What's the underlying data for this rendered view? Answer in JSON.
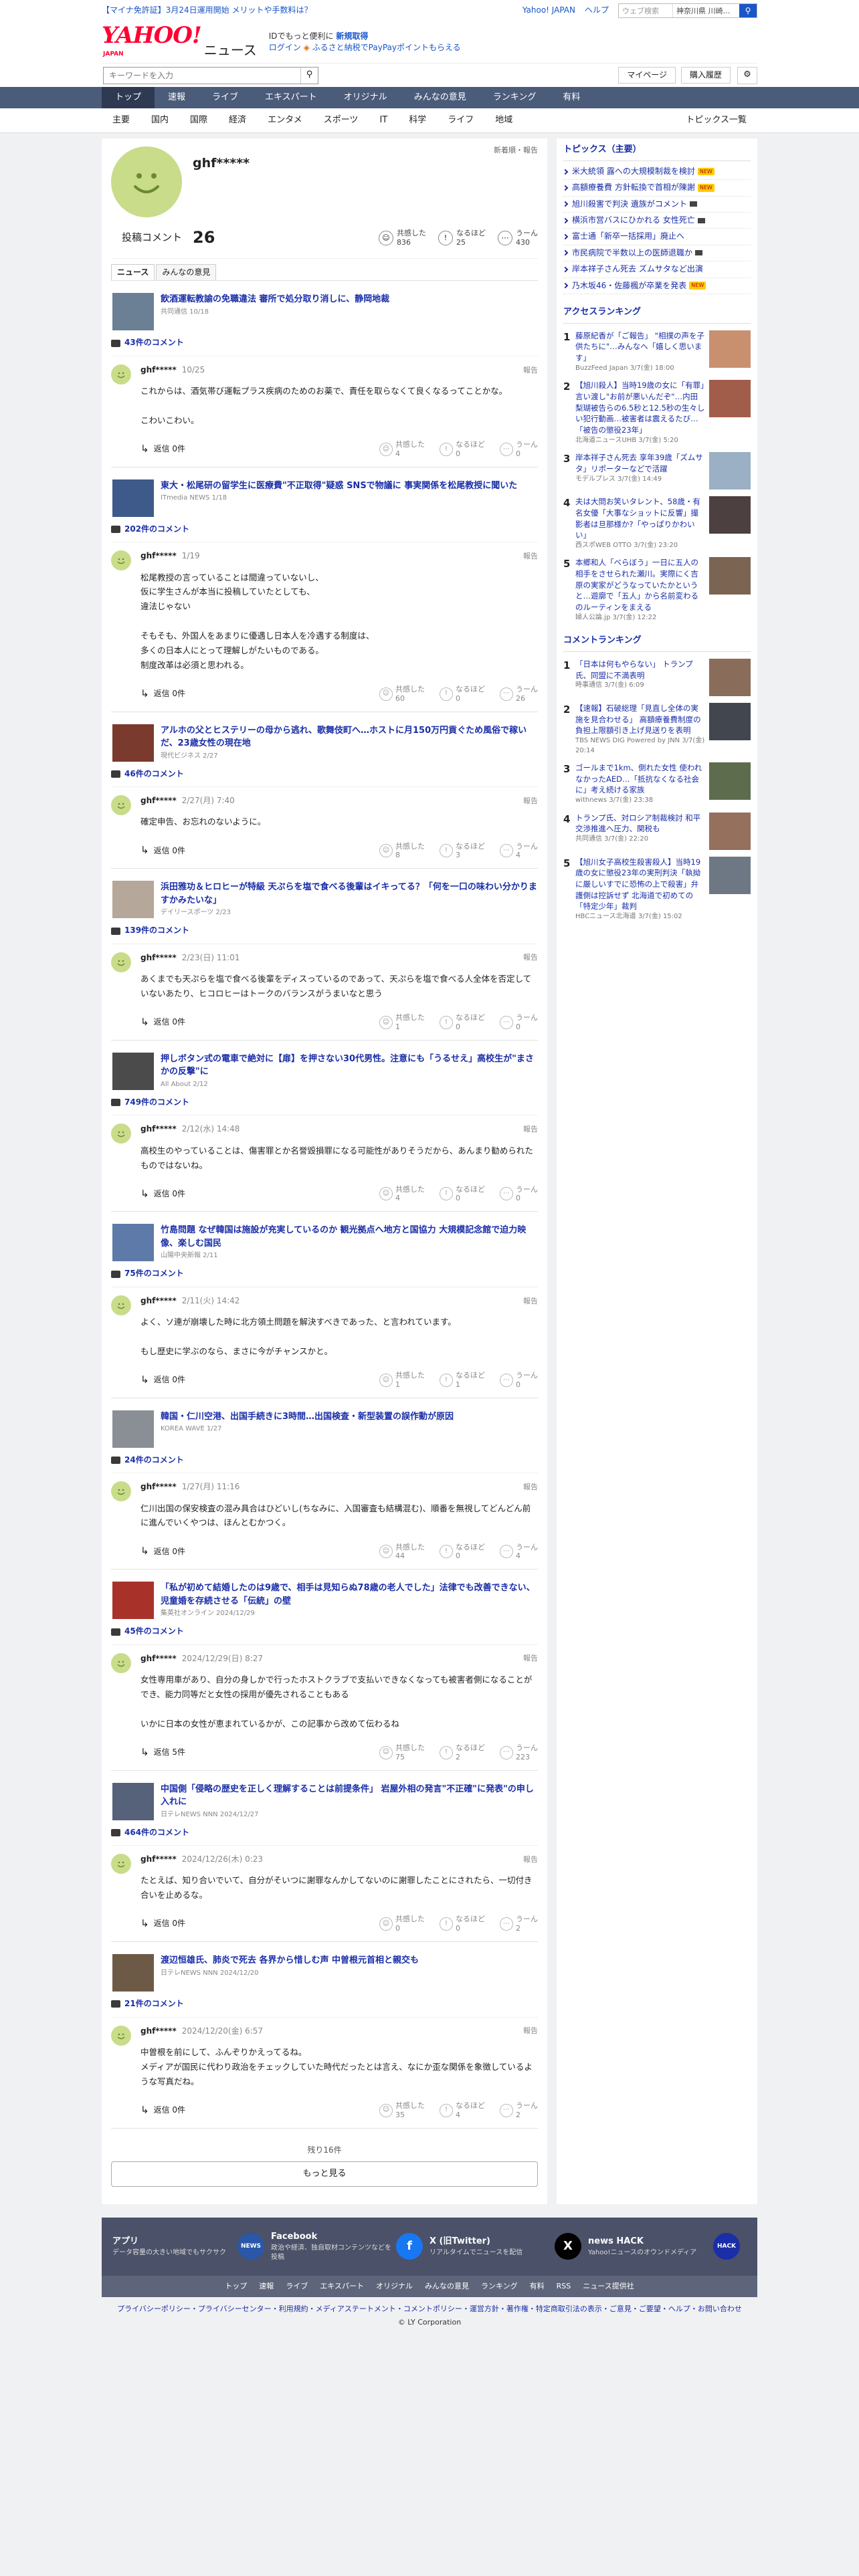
{
  "topbar": {
    "promo": "【マイナ免許証】3月24日運用開始 メリットや手数料は？",
    "links": [
      "Yahoo! JAPAN",
      "ヘルプ"
    ],
    "weather_placeholder": "ウェブ検索",
    "weather_location": "神奈川県 川崎…"
  },
  "header": {
    "logo_yahoo": "YAHOO!",
    "logo_japan": "JAPAN",
    "logo_news": "ニュース",
    "line1": "IDでもっと便利に",
    "line1_link": "新規取得",
    "login": "ログイン",
    "line2": "ふるさと納税でPayPayポイントもらえる"
  },
  "search": {
    "placeholder": "キーワードを入力",
    "mypage": "マイページ",
    "history": "購入履歴"
  },
  "main_nav": [
    "トップ",
    "速報",
    "ライブ",
    "エキスパート",
    "オリジナル",
    "みんなの意見",
    "ランキング",
    "有料"
  ],
  "sub_nav": [
    "主要",
    "国内",
    "国際",
    "経済",
    "エンタメ",
    "スポーツ",
    "IT",
    "科学",
    "ライフ",
    "地域"
  ],
  "sub_nav_right": "トピックス一覧",
  "profile": {
    "name": "ghf*****",
    "newest": "新着順・報告",
    "posted_label": "投稿コメント",
    "posted_count": "26",
    "stats": [
      {
        "label": "共感した",
        "value": "836"
      },
      {
        "label": "なるほど",
        "value": "25"
      },
      {
        "label": "うーん",
        "value": "430"
      }
    ],
    "tabs": [
      "ニュース",
      "みんなの意見"
    ]
  },
  "labels": {
    "reply": "返信",
    "report": "報告",
    "like": "共感した",
    "naruhodo": "なるほど",
    "hmm": "うーん",
    "remaining": "残り16件",
    "more": "もっと見る"
  },
  "items": [
    {
      "title": "飲酒運転教諭の免職違法 審所で処分取り消しに、静岡地裁",
      "source": "共同通信 10/18",
      "comments": "43件のコメント",
      "date": "10/25",
      "text": "これからは、酒気帯び運転プラス疾病のためのお薬で、責任を取らなくて良くなるってことかな。\n\nこわいこわい。",
      "replies": "返信 0件",
      "like": "4",
      "naru": "0",
      "hmm": "0",
      "color": "#6b7f95"
    },
    {
      "title": "東大・松尾研の留学生に医療費\"不正取得\"疑惑 SNSで物議に 事実関係を松尾教授に聞いた",
      "source": "ITmedia NEWS 1/18",
      "comments": "202件のコメント",
      "date": "1/19",
      "text": "松尾教授の言っていることは間違っていないし、\n仮に学生さんが本当に投稿していたとしても、\n違法じゃない\n\nそもそも、外国人をあまりに優遇し日本人を冷遇する制度は、\n多くの日本人にとって理解しがたいものである。\n制度改革は必須と思われる。",
      "replies": "返信 0件",
      "like": "60",
      "naru": "0",
      "hmm": "26",
      "color": "#3d5a8a"
    },
    {
      "title": "アルホの父とヒステリーの母から逃れ、歌舞伎町へ…ホストに月150万円貢ぐため風俗で稼いだ、23歳女性の現在地",
      "source": "現代ビジネス 2/27",
      "comments": "46件のコメント",
      "date": "2/27(月) 7:40",
      "text": "確定申告、お忘れのないように。",
      "replies": "返信 0件",
      "like": "8",
      "naru": "3",
      "hmm": "4",
      "color": "#7a3b2e"
    },
    {
      "title": "浜田雅功＆ヒロヒーが特級 天ぷらを塩で食べる後輩はイキってる？「何を一口の味わい分かりますかみたいな」",
      "source": "デイリースポーツ 2/23",
      "comments": "139件のコメント",
      "date": "2/23(日) 11:01",
      "text": "あくまでも天ぷらを塩で食べる後輩をディスっているのであって、天ぷらを塩で食べる人全体を否定していないあたり、ヒコロヒーはトークのバランスがうまいなと思う",
      "replies": "返信 0件",
      "like": "1",
      "naru": "0",
      "hmm": "0",
      "color": "#b5a79a"
    },
    {
      "title": "押しボタン式の電車で絶対に【扉】を押さない30代男性。注意にも「うるせえ」高校生が\"まさかの反撃\"に",
      "source": "All About 2/12",
      "comments": "749件のコメント",
      "date": "2/12(水) 14:48",
      "text": "高校生のやっていることは、傷害罪とか名誉毀損罪になる可能性がありそうだから、あんまり勧められたものではないね。",
      "replies": "返信 0件",
      "like": "4",
      "naru": "0",
      "hmm": "0",
      "color": "#4b4b4b"
    },
    {
      "title": "竹島問題 なぜ韓国は施設が充実しているのか 観光拠点へ地方と国協力 大規模記念館で迫力映像、楽しむ国民",
      "source": "山陽中央新報 2/11",
      "comments": "75件のコメント",
      "date": "2/11(火) 14:42",
      "text": "よく、ソ連が崩壊した時に北方領土問題を解決すべきであった、と言われています。\n\nもし歴史に学ぶのなら、まさに今がチャンスかと。",
      "replies": "返信 0件",
      "like": "1",
      "naru": "1",
      "hmm": "0",
      "color": "#5d7aa8"
    },
    {
      "title": "韓国・仁川空港、出国手続きに3時間…出国検査・新型装置の誤作動が原因",
      "source": "KOREA WAVE 1/27",
      "comments": "24件のコメント",
      "date": "1/27(月) 11:16",
      "text": "仁川出国の保安検査の混み具合はひどいし(ちなみに、入国審査も結構混む)、順番を無視してどんどん前に進んでいくやつは、ほんとむかつく。",
      "replies": "返信 0件",
      "like": "44",
      "naru": "0",
      "hmm": "4",
      "color": "#8a8f96"
    },
    {
      "title": "「私が初めて結婚したのは9歳で、相手は見知らぬ78歳の老人でした」法律でも改善できない、児童婚を存続させる「伝統」の壁",
      "source": "集英社オンライン 2024/12/29",
      "comments": "45件のコメント",
      "date": "2024/12/29(日) 8:27",
      "text": "女性専用車があり、自分の身しかで行ったホストクラブで支払いできなくなっても被害者側になることができ、能力同等だと女性の採用が優先されることもある\n\nいかに日本の女性が恵まれているかが、この記事から改めて伝わるね",
      "replies": "返信 5件",
      "like": "75",
      "naru": "2",
      "hmm": "223",
      "color": "#a8322a"
    },
    {
      "title": "中国側「侵略の歴史を正しく理解することは前提条件」 岩屋外相の発言\"不正確\"に発表\"の申し入れに",
      "source": "日テレNEWS NNN 2024/12/27",
      "comments": "464件のコメント",
      "date": "2024/12/26(木) 0:23",
      "text": "たとえば、知り合いでいて、自分がそいつに謝罪なんかしてないのに謝罪したことにされたら、一切付き合いを止めるな。",
      "replies": "返信 0件",
      "like": "0",
      "naru": "0",
      "hmm": "2",
      "color": "#56617a"
    },
    {
      "title": "渡辺恒雄氏、肺炎で死去 各界から惜しむ声 中曽根元首相と親交も",
      "source": "日テレNEWS NNN 2024/12/20",
      "comments": "21件のコメント",
      "date": "2024/12/20(金) 6:57",
      "text": "中曽根を前にして、ふんぞりかえってるね。\nメディアが国民に代わり政治をチェックしていた時代だったとは言え、なにか歪な関係を象徴しているような写真だね。",
      "replies": "返信 0件",
      "like": "35",
      "naru": "4",
      "hmm": "2",
      "color": "#6d5a46"
    }
  ],
  "side": {
    "topics_title": "トピックス（主要）",
    "topics": [
      {
        "text": "米大統領 露への大規模制裁を検討",
        "badge": "NEW",
        "cam": false
      },
      {
        "text": "高額療養費 方針転換で首相が陳謝",
        "badge": "NEW",
        "cam": false
      },
      {
        "text": "旭川殺害で判決 遺族がコメント",
        "badge": "",
        "cam": true
      },
      {
        "text": "横浜市営バスにひかれる 女性死亡",
        "badge": "",
        "cam": true
      },
      {
        "text": "富士通「新卒一括採用」廃止へ",
        "badge": "",
        "cam": false
      },
      {
        "text": "市民病院で半数以上の医師退職か",
        "badge": "",
        "cam": true
      },
      {
        "text": "岸本祥子さん死去 ズムサタなど出演",
        "badge": "",
        "cam": false
      },
      {
        "text": "乃木坂46・佐藤楓が卒業を発表",
        "badge": "NEW",
        "cam": false
      }
    ],
    "access_title": "アクセスランキング",
    "access": [
      {
        "text": "藤原紀香が「ご報告」 \"相撲の声を子供たちに\"…みんなへ「嬉しく思います」",
        "meta": "BuzzFeed Japan 3/7(金) 18:00",
        "color": "#c99070"
      },
      {
        "text": "【旭川殺人】当時19歳の女に「有罪」言い渡し\"お前が悪いんだぞ\"…内田梨瑚被告らの6.5秒と12.5秒の生々しい犯行動画…被害者は震えるたび…「被告の懲役23年」",
        "meta": "北海道ニュースUHB 3/7(金) 5:20",
        "color": "#a25d4a"
      },
      {
        "text": "岸本祥子さん死去 享年39歳「ズムサタ」リポーターなどで活躍",
        "meta": "モデルプレス 3/7(金) 14:49",
        "color": "#9bb0c4"
      },
      {
        "text": "夫は大問お笑いタレント、58歳・有名女優「大事なショットに反響」撮影者は旦那様か?「やっぱりかわいい」",
        "meta": "西スポWEB OTTO 3/7(金) 23:20",
        "color": "#4d4040"
      },
      {
        "text": "本郷和人「べらぼう」一日に五人の相手をさせられた瀬川。実際にく吉原の実家がどうなっていたかというと…遊廓で「五人」から名前変わるのルーティンをまえる",
        "meta": "婦人公論.jp 3/7(金) 12:22",
        "color": "#7c6452"
      }
    ],
    "comment_title": "コメントランキング",
    "comment": [
      {
        "text": "「日本は何もやらない」 トランプ氏、同盟に不満表明",
        "meta": "時事通信 3/7(金) 6:09",
        "color": "#8a6c5a"
      },
      {
        "text": "【速報】石破総理「見直し全体の実施を見合わせる」 高額療養費制度の負担上限額引き上げ見送りを表明",
        "meta": "TBS NEWS DIG Powered by JNN 3/7(金) 20:14",
        "color": "#41464f"
      },
      {
        "text": "ゴールまで1km、倒れた女性 使われなかったAED…「抵抗なくなる社会に」考え続ける家族",
        "meta": "withnews 3/7(金) 23:38",
        "color": "#5e6c4e"
      },
      {
        "text": "トランプ氏、対ロシア制裁検討 和平交渉推進へ圧力、関税も",
        "meta": "共同通信 3/7(金) 22:20",
        "color": "#94705d"
      },
      {
        "text": "【旭川女子高校生殺害殺人】当時19歳の女に懲役23年の実刑判決「執拗に厳しいすでに恐怖の上で殺害」弁護側は控訴せず 北海道で初めての「特定少年」裁判",
        "meta": "HBCニュース北海道 3/7(金) 15:02",
        "color": "#6d7884"
      }
    ]
  },
  "footer": {
    "cards": [
      {
        "title": "アプリ",
        "desc": "データ容量の大きい地域でもサクサク",
        "icon": "NEWS",
        "color": "#2a57a8"
      },
      {
        "title": "Facebook",
        "desc": "政治や経済、独自取材コンテンツなどを投稿",
        "icon": "f",
        "color": "#1877f2"
      },
      {
        "title": "X (旧Twitter)",
        "desc": "リアルタイムでニュースを配信",
        "icon": "X",
        "color": "#000000"
      },
      {
        "title": "news HACK",
        "desc": "Yahoo!ニュースのオウンドメディア",
        "icon": "HACK",
        "color": "#1a2ea8"
      }
    ],
    "nav": [
      "トップ",
      "速報",
      "ライブ",
      "エキスパート",
      "オリジナル",
      "みんなの意見",
      "ランキング",
      "有料",
      "RSS",
      "ニュース提供社"
    ],
    "legal": "プライバシーポリシー・プライバシーセンター・利用規約・メディアステートメント・コメントポリシー・運営方針・著作権・特定商取引法の表示・ご意見・ご要望・ヘルプ・お問い合わせ",
    "copyright": "© LY Corporation"
  }
}
